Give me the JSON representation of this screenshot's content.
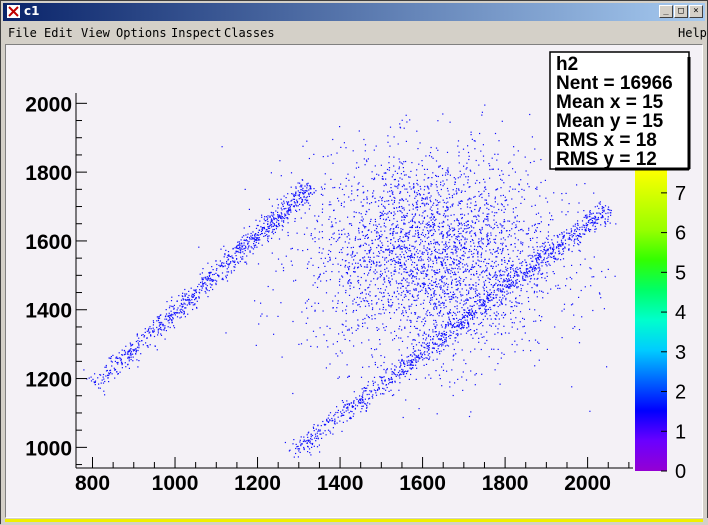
{
  "window": {
    "title": "c1",
    "buttons": {
      "minimize": "_",
      "maximize": "□",
      "close": "×"
    }
  },
  "menubar": {
    "items": [
      "File",
      "Edit",
      "View",
      "Options",
      "Inspect",
      "Classes"
    ],
    "help": "Help"
  },
  "stats_box": {
    "name": "h2",
    "lines": [
      "Nent = 16966",
      "Mean x =   15",
      "Mean y =   15",
      "RMS x  =   18",
      "RMS y  =   12"
    ]
  },
  "colors": {
    "points": "#1010ff",
    "canvas_bg": "#f4f1f6",
    "titlebar_start": "#0a246a",
    "titlebar_end": "#a6caf0"
  },
  "chart_data": {
    "type": "scatter",
    "title": "",
    "xlabel": "",
    "ylabel": "",
    "xlim": [
      760,
      2110
    ],
    "ylim": [
      940,
      2030
    ],
    "x_ticks": [
      "800",
      "1000",
      "1200",
      "1400",
      "1600",
      "1800",
      "2000"
    ],
    "y_ticks": [
      "1000",
      "1200",
      "1400",
      "1600",
      "1800",
      "2000"
    ],
    "x_tick_values": [
      800,
      1000,
      1200,
      1400,
      1600,
      1800,
      2000
    ],
    "y_tick_values": [
      1000,
      1200,
      1400,
      1600,
      1800,
      2000
    ],
    "entries": 16966,
    "components": [
      {
        "name": "band-upper-left",
        "shape": "band",
        "from": [
          800,
          1180
        ],
        "to": [
          1330,
          1760
        ],
        "weight": 0.18
      },
      {
        "name": "blob-center",
        "shape": "gauss2d",
        "mean": [
          1620,
          1560
        ],
        "sd": [
          150,
          150
        ],
        "weight": 0.6
      },
      {
        "name": "band-lower-right",
        "shape": "band",
        "from": [
          1280,
          980
        ],
        "to": [
          2050,
          1700
        ],
        "weight": 0.22
      }
    ],
    "palette": {
      "labels": [
        "0",
        "1",
        "2",
        "3",
        "4",
        "5",
        "6",
        "7"
      ],
      "colors": [
        "#9400d3",
        "#6a00ff",
        "#0000ff",
        "#0066ff",
        "#00ccff",
        "#00ffcc",
        "#00ff66",
        "#33ff00",
        "#99ff00",
        "#ccff00",
        "#ffff00"
      ]
    }
  }
}
